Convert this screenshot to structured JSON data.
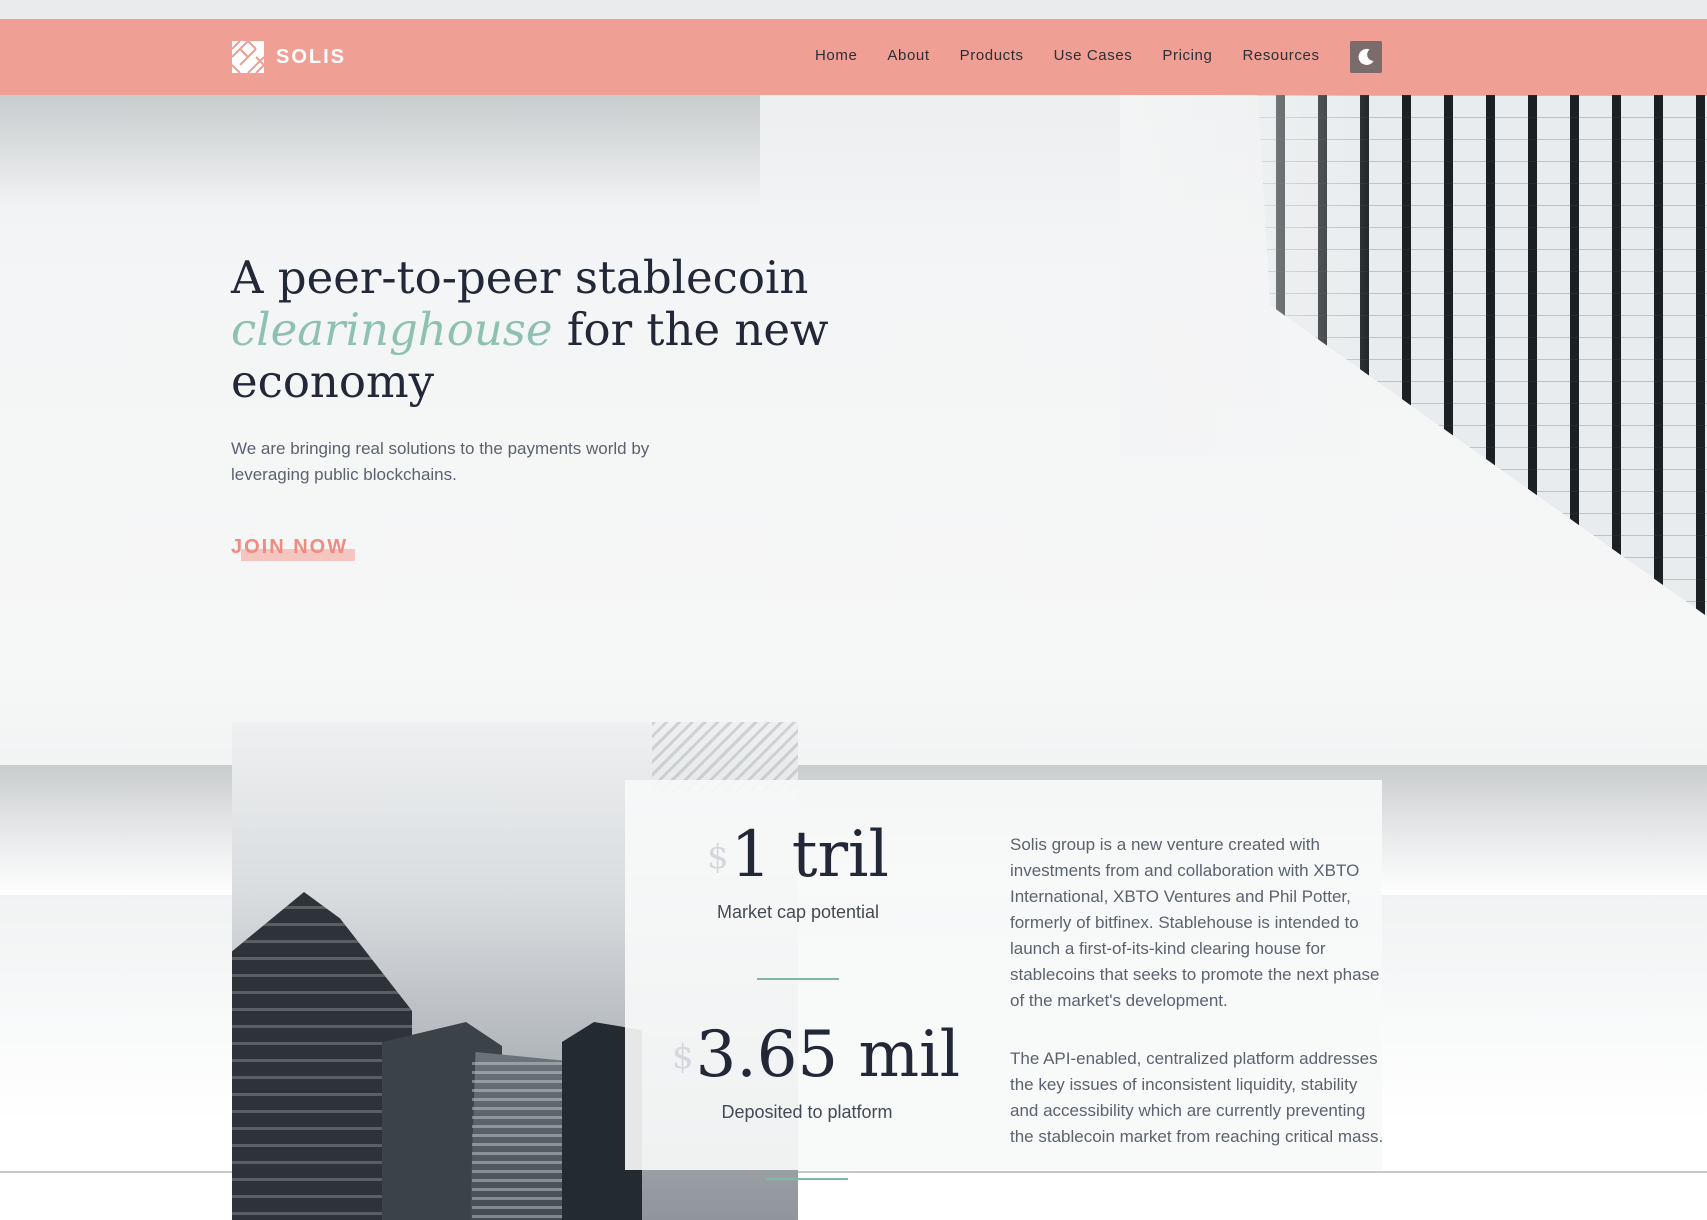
{
  "brand": {
    "name": "SOLIS",
    "accent_color": "#f09c92",
    "highlight_color": "#8ec1b0"
  },
  "nav": {
    "items": [
      {
        "label": "Home"
      },
      {
        "label": "About"
      },
      {
        "label": "Products"
      },
      {
        "label": "Use Cases"
      },
      {
        "label": "Pricing"
      },
      {
        "label": "Resources"
      }
    ],
    "theme_toggle_icon": "moon-icon"
  },
  "hero": {
    "title_part1": "A peer-to-peer stablecoin ",
    "title_accent": "clearinghouse",
    "title_part2": " for the new economy",
    "subtitle": "We are bringing real solutions to the payments world by leveraging public blockchains.",
    "cta_label": "JOIN NOW"
  },
  "stats": [
    {
      "currency": "$",
      "value": "1 tril",
      "label": "Market cap potential"
    },
    {
      "currency": "$",
      "value": "3.65 mil",
      "label": "Deposited to platform"
    }
  ],
  "about": {
    "paragraphs": [
      "Solis group is a new venture created with investments from and collaboration with XBTO International, XBTO Ventures and Phil Potter, formerly of bitfinex. Stablehouse is intended to launch a first-of-its-kind clearing house for stablecoins that seeks to promote the next phase of the market's development.",
      "The API-enabled, centralized platform addresses the key issues of inconsistent liquidity, stability and accessibility which are currently preventing the stablecoin market from reaching critical mass."
    ]
  }
}
